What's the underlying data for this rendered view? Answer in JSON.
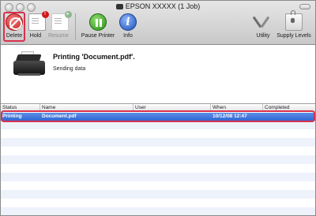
{
  "window": {
    "title": "EPSON XXXXX (1 Job)"
  },
  "toolbar": {
    "delete_label": "Delete",
    "hold_label": "Hold",
    "resume_label": "Resume",
    "pause_label": "Pause Printer",
    "info_label": "Info",
    "utility_label": "Utility",
    "supply_label": "Supply Levels"
  },
  "status": {
    "title": "Printing 'Document.pdf'.",
    "subtitle": "Sending data"
  },
  "jobs": {
    "columns": [
      "Status",
      "Name",
      "User",
      "When",
      "Completed"
    ],
    "rows": [
      {
        "status": "Printing",
        "name": "Document.pdf",
        "user": "",
        "when": "10/12/08 12:47",
        "completed": ""
      }
    ]
  },
  "colors": {
    "selection": "#3a6fd8",
    "highlight_outline": "#d9314d",
    "stripe": "#eef2fb"
  }
}
